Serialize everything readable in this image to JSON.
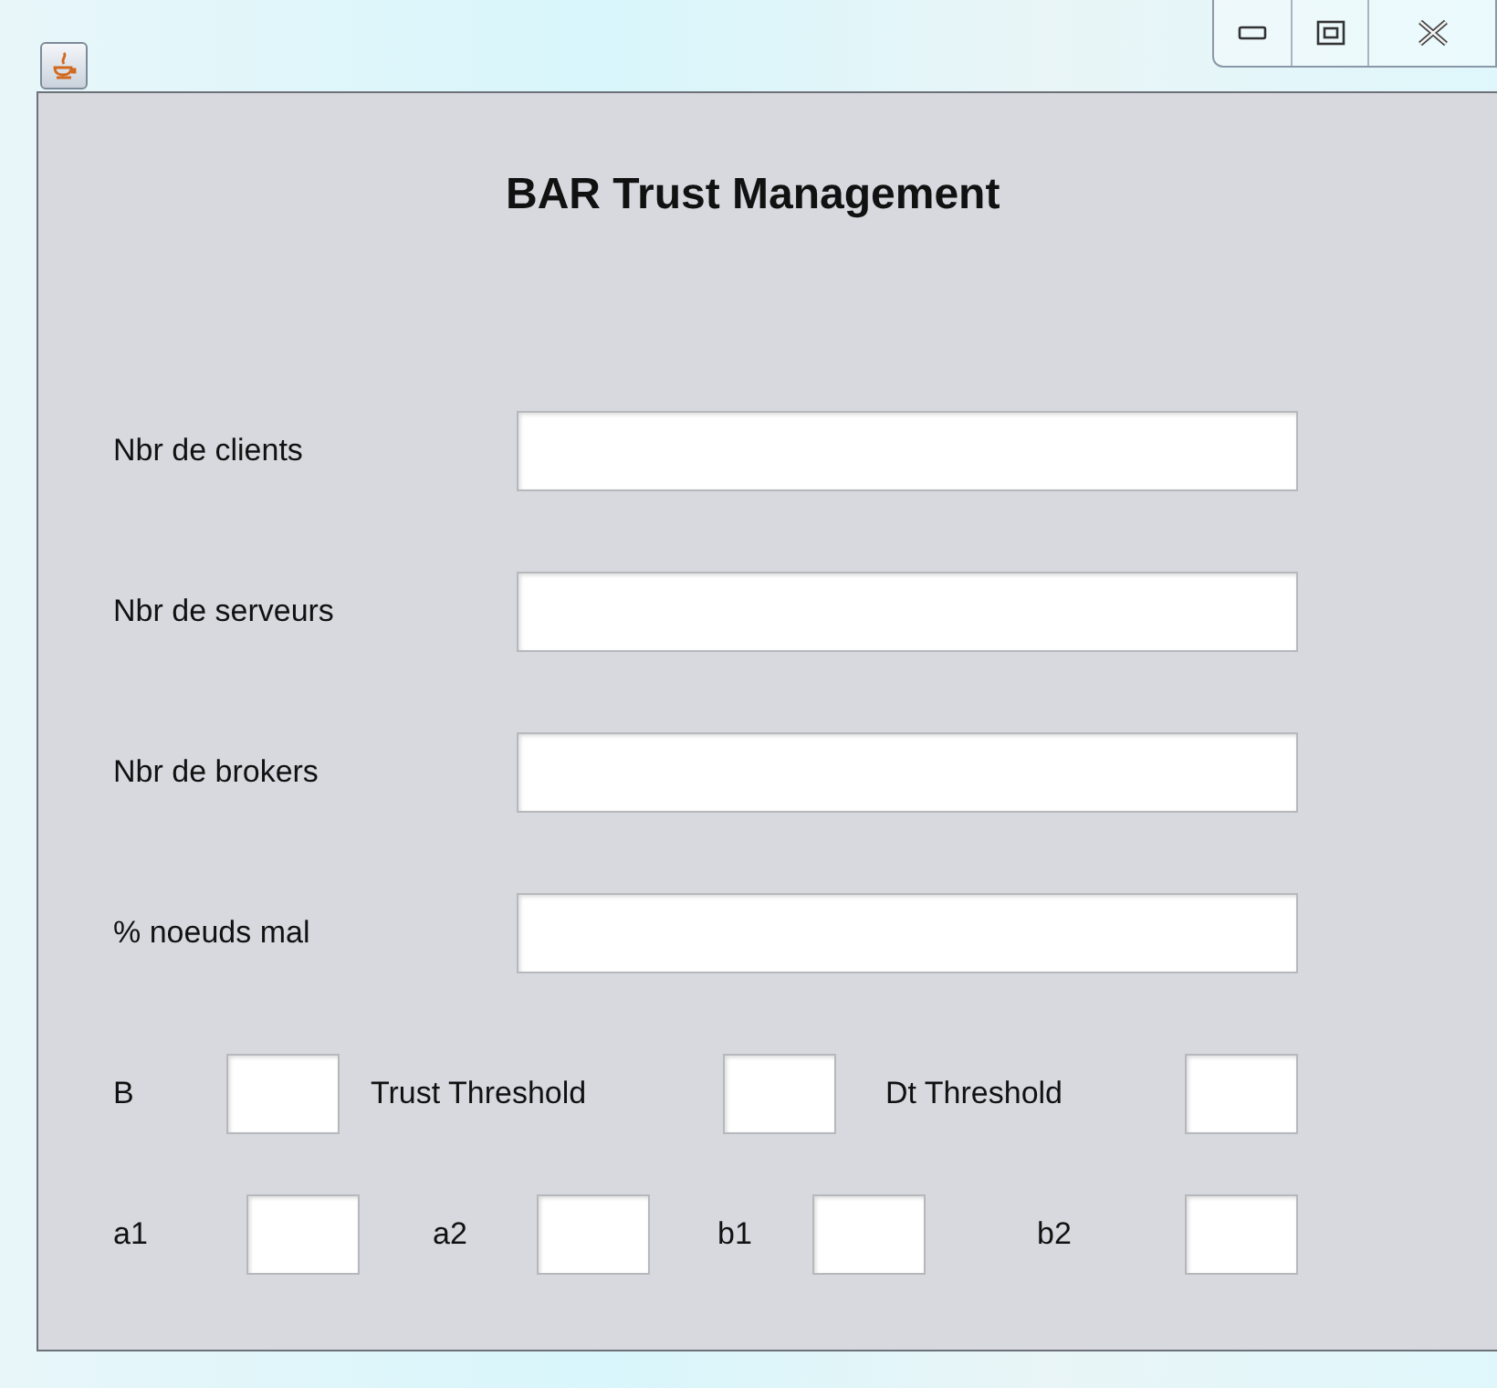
{
  "title": "BAR Trust Management",
  "fields": [
    {
      "label": "Nbr de clients"
    },
    {
      "label": "Nbr de serveurs"
    },
    {
      "label": "Nbr de brokers"
    },
    {
      "label": "% noeuds mal"
    }
  ],
  "parameter_rows": [
    [
      {
        "label": "B"
      },
      {
        "label": "Trust Threshold"
      },
      {
        "label": "Dt Threshold"
      }
    ],
    [
      {
        "label": "a1"
      },
      {
        "label": "a2"
      },
      {
        "label": "b1"
      },
      {
        "label": "b2"
      }
    ]
  ]
}
